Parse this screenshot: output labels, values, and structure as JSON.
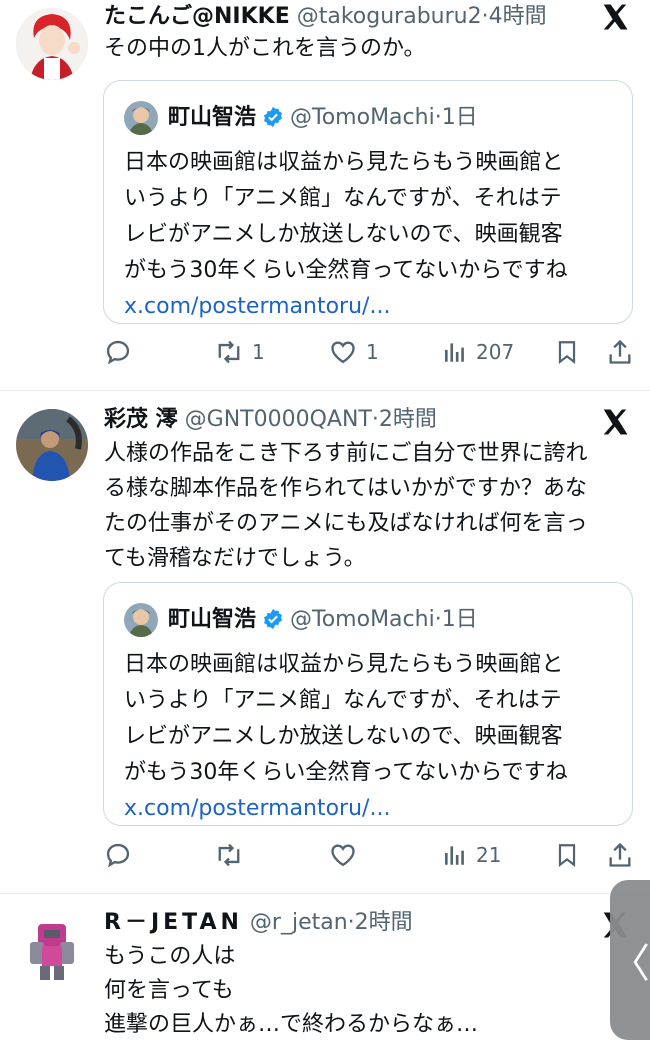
{
  "tweets": [
    {
      "name": "たこんご@NIKKE",
      "handle": "@takoguraburu2",
      "dot": "·",
      "time": "4時間",
      "text": "その中の1人がこれを言うのか。",
      "quote": {
        "name": "町山智浩",
        "handle": "@TomoMachi",
        "dot": "·",
        "time": "1日",
        "lines": [
          "日本の映画館は収益から見たらもう映画館と",
          "いうより「アニメ館」なんですが、それはテ",
          "レビがアニメしか放送しないので、映画観客",
          "がもう30年くらい全然育ってないからですね"
        ],
        "link": "x.com/postermantoru/..."
      },
      "actions": {
        "reply": "",
        "retweet": "1",
        "like": "1",
        "views": "207"
      }
    },
    {
      "name": "彩茂 澪",
      "handle": "@GNT0000QANT",
      "dot": "·",
      "time": "2時間",
      "lines": [
        "人様の作品をこき下ろす前にご自分で世界に誇れ",
        "る様な脚本作品を作られてはいかがですか？あな",
        "たの仕事がそのアニメにも及ばなければ何を言っ",
        "ても滑稽なだけでしょう。"
      ],
      "quote": {
        "name": "町山智浩",
        "handle": "@TomoMachi",
        "dot": "·",
        "time": "1日",
        "lines": [
          "日本の映画館は収益から見たらもう映画館と",
          "いうより「アニメ館」なんですが、それはテ",
          "レビがアニメしか放送しないので、映画観客",
          "がもう30年くらい全然育ってないからですね"
        ],
        "link": "x.com/postermantoru/..."
      },
      "actions": {
        "reply": "",
        "retweet": "",
        "like": "",
        "views": "21"
      }
    },
    {
      "name": "R－JETAN",
      "handle": "@r_jetan",
      "dot": "·",
      "time": "2時間",
      "lines": [
        "もうこの人は",
        "何を言っても",
        "進撃の巨人かぁ…で終わるからなぁ…"
      ]
    }
  ],
  "side_handle": "〈",
  "colors": {
    "verified": "#1d9bf0",
    "link": "#1d63c7",
    "muted": "#536471",
    "border": "#cfd9de"
  }
}
